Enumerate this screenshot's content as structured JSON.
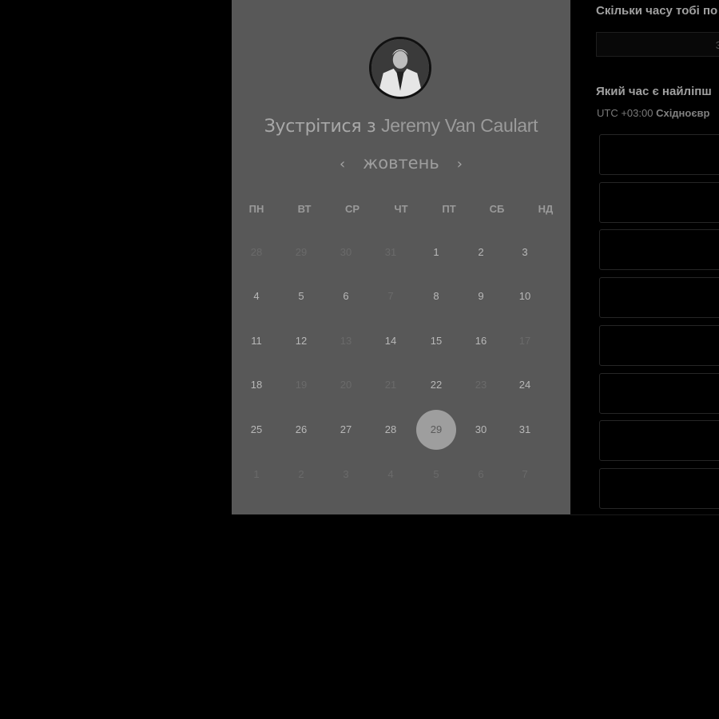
{
  "calendar": {
    "title_prefix": "Зустрітися з",
    "host_name": "Jeremy Van Caulart",
    "month": "жовтень",
    "prev_icon": "‹",
    "next_icon": "›",
    "weekdays": [
      "ПН",
      "ВТ",
      "СР",
      "ЧТ",
      "ПТ",
      "СБ",
      "НД"
    ],
    "weeks": [
      [
        {
          "d": "28",
          "s": "muted"
        },
        {
          "d": "29",
          "s": "muted"
        },
        {
          "d": "30",
          "s": "muted"
        },
        {
          "d": "31",
          "s": "muted"
        },
        {
          "d": "1",
          "s": "active"
        },
        {
          "d": "2",
          "s": "active"
        },
        {
          "d": "3",
          "s": "active"
        }
      ],
      [
        {
          "d": "4",
          "s": "active"
        },
        {
          "d": "5",
          "s": "active"
        },
        {
          "d": "6",
          "s": "active"
        },
        {
          "d": "7",
          "s": "muted"
        },
        {
          "d": "8",
          "s": "active"
        },
        {
          "d": "9",
          "s": "active"
        },
        {
          "d": "10",
          "s": "active"
        }
      ],
      [
        {
          "d": "11",
          "s": "active"
        },
        {
          "d": "12",
          "s": "active"
        },
        {
          "d": "13",
          "s": "muted"
        },
        {
          "d": "14",
          "s": "active"
        },
        {
          "d": "15",
          "s": "active"
        },
        {
          "d": "16",
          "s": "active"
        },
        {
          "d": "17",
          "s": "muted"
        }
      ],
      [
        {
          "d": "18",
          "s": "active"
        },
        {
          "d": "19",
          "s": "muted"
        },
        {
          "d": "20",
          "s": "muted"
        },
        {
          "d": "21",
          "s": "muted"
        },
        {
          "d": "22",
          "s": "active"
        },
        {
          "d": "23",
          "s": "muted"
        },
        {
          "d": "24",
          "s": "active"
        }
      ],
      [
        {
          "d": "25",
          "s": "active"
        },
        {
          "d": "26",
          "s": "active"
        },
        {
          "d": "27",
          "s": "active"
        },
        {
          "d": "28",
          "s": "active"
        },
        {
          "d": "29",
          "s": "selected"
        },
        {
          "d": "30",
          "s": "active"
        },
        {
          "d": "31",
          "s": "active"
        }
      ],
      [
        {
          "d": "1",
          "s": "muted"
        },
        {
          "d": "2",
          "s": "muted"
        },
        {
          "d": "3",
          "s": "muted"
        },
        {
          "d": "4",
          "s": "muted"
        },
        {
          "d": "5",
          "s": "muted"
        },
        {
          "d": "6",
          "s": "muted"
        },
        {
          "d": "7",
          "s": "muted"
        }
      ]
    ]
  },
  "scheduler": {
    "duration_label": "Скільки часу тобі по",
    "duration_value": "3",
    "time_label": "Який час є найліпш",
    "tz_offset": "UTC +03:00",
    "tz_name": "Східноєвр",
    "slot_count": 8
  },
  "colors": {
    "panel_bg": "#585858",
    "selected_day": "#9e9e9e",
    "page_bg": "#000000"
  }
}
